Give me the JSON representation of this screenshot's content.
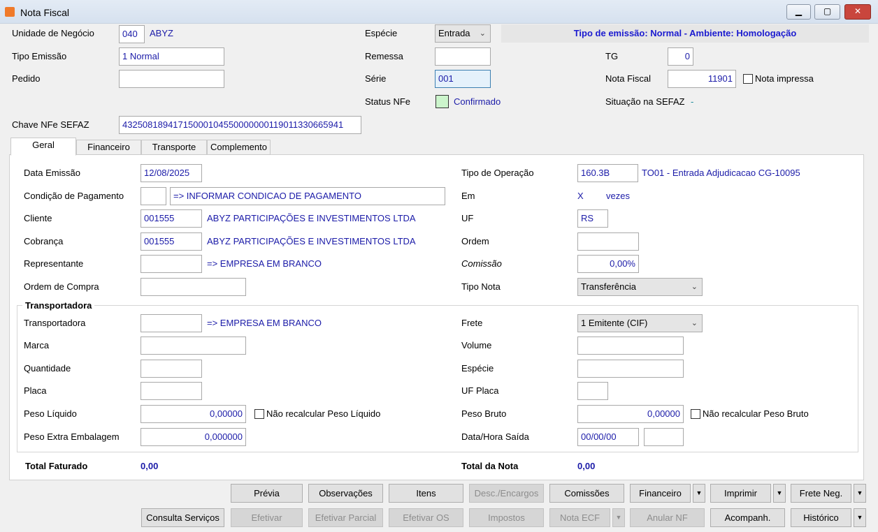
{
  "window": {
    "title": "Nota Fiscal",
    "minimize": "▁",
    "maximize": "▢",
    "close": "✕"
  },
  "header": {
    "unidade_label": "Unidade de Negócio",
    "unidade_code": "040",
    "unidade_name": "ABYZ",
    "tipo_emissao_label": "Tipo Emissão",
    "tipo_emissao": "1 Normal",
    "pedido_label": "Pedido",
    "pedido": "",
    "especie_label": "Espécie",
    "especie": "Entrada",
    "remessa_label": "Remessa",
    "remessa": "",
    "serie_label": "Série",
    "serie": "001",
    "status_label": "Status NFe",
    "status": "Confirmado",
    "status_color": "#ccf5cc",
    "banner": "Tipo de emissão: Normal - Ambiente: Homologação",
    "tg_label": "TG",
    "tg": "0",
    "nf_label": "Nota Fiscal",
    "nf": "11901",
    "nota_impressa": "Nota impressa",
    "situacao_label": "Situação na SEFAZ",
    "situacao": "-",
    "chave_label": "Chave NFe SEFAZ",
    "chave": "43250818941715000104550000000119011330665941"
  },
  "tabs": [
    {
      "label": "Geral",
      "active": true
    },
    {
      "label": "Financeiro"
    },
    {
      "label": "Transporte"
    },
    {
      "label": "Complemento"
    }
  ],
  "geral": {
    "data_emissao_label": "Data Emissão",
    "data_emissao": "12/08/2025",
    "condicao_label": "Condição de Pagamento",
    "condicao_code": "",
    "condicao": "=> INFORMAR CONDICAO DE PAGAMENTO",
    "cliente_label": "Cliente",
    "cliente_code": "001555",
    "cliente_name": "ABYZ PARTICIPAÇÕES E INVESTIMENTOS LTDA",
    "cobranca_label": "Cobrança",
    "cobranca_code": "001555",
    "cobranca_name": "ABYZ PARTICIPAÇÕES E INVESTIMENTOS LTDA",
    "representante_label": "Representante",
    "representante_code": "",
    "representante_name": "=> EMPRESA EM BRANCO",
    "ordem_compra_label": "Ordem de Compra",
    "ordem_compra": "",
    "tipo_operacao_label": "Tipo de Operação",
    "tipo_operacao": "160.3B",
    "tipo_operacao_desc": "TO01 - Entrada Adjudicacao CG-10095",
    "em_label": "Em",
    "em_x": "X",
    "em_vezes": "vezes",
    "uf_label": "UF",
    "uf": "RS",
    "ordem_label": "Ordem",
    "ordem": "",
    "comissao_label": "Comissão",
    "comissao": "0,00%",
    "tipo_nota_label": "Tipo Nota",
    "tipo_nota": "Transferência"
  },
  "transportadora": {
    "group_label": "Transportadora",
    "transp_label": "Transportadora",
    "transp_code": "",
    "transp_name": "=> EMPRESA EM BRANCO",
    "marca_label": "Marca",
    "marca": "",
    "quantidade_label": "Quantidade",
    "quantidade": "",
    "placa_label": "Placa",
    "placa": "",
    "peso_liquido_label": "Peso Líquido",
    "peso_liquido": "0,00000",
    "nao_recalc_liquido": "Não recalcular Peso Líquido",
    "peso_extra_label": "Peso Extra Embalagem",
    "peso_extra": "0,000000",
    "frete_label": "Frete",
    "frete": "1 Emitente (CIF)",
    "volume_label": "Volume",
    "volume": "",
    "especie_label": "Espécie",
    "especie": "",
    "uf_placa_label": "UF Placa",
    "uf_placa": "",
    "peso_bruto_label": "Peso Bruto",
    "peso_bruto": "0,00000",
    "nao_recalc_bruto": "Não recalcular Peso Bruto",
    "data_saida_label": "Data/Hora Saída",
    "data_saida": "00/00/00",
    "hora_saida": ""
  },
  "totals": {
    "faturado_label": "Total Faturado",
    "faturado": "0,00",
    "nota_label": "Total da Nota",
    "nota": "0,00"
  },
  "buttons": {
    "previa": "Prévia",
    "observacoes": "Observações",
    "itens": "Itens",
    "desc_encargos": "Desc./Encargos",
    "comissoes": "Comissões",
    "financeiro": "Financeiro",
    "imprimir": "Imprimir",
    "frete_neg": "Frete Neg.",
    "consulta_servicos": "Consulta Serviços",
    "efetivar": "Efetivar",
    "efetivar_parcial": "Efetivar Parcial",
    "efetivar_os": "Efetivar OS",
    "impostos": "Impostos",
    "nota_ecf": "Nota ECF",
    "anular_nf": "Anular NF",
    "acompanh": "Acompanh.",
    "historico": "Histórico",
    "dropdown": "▼"
  }
}
